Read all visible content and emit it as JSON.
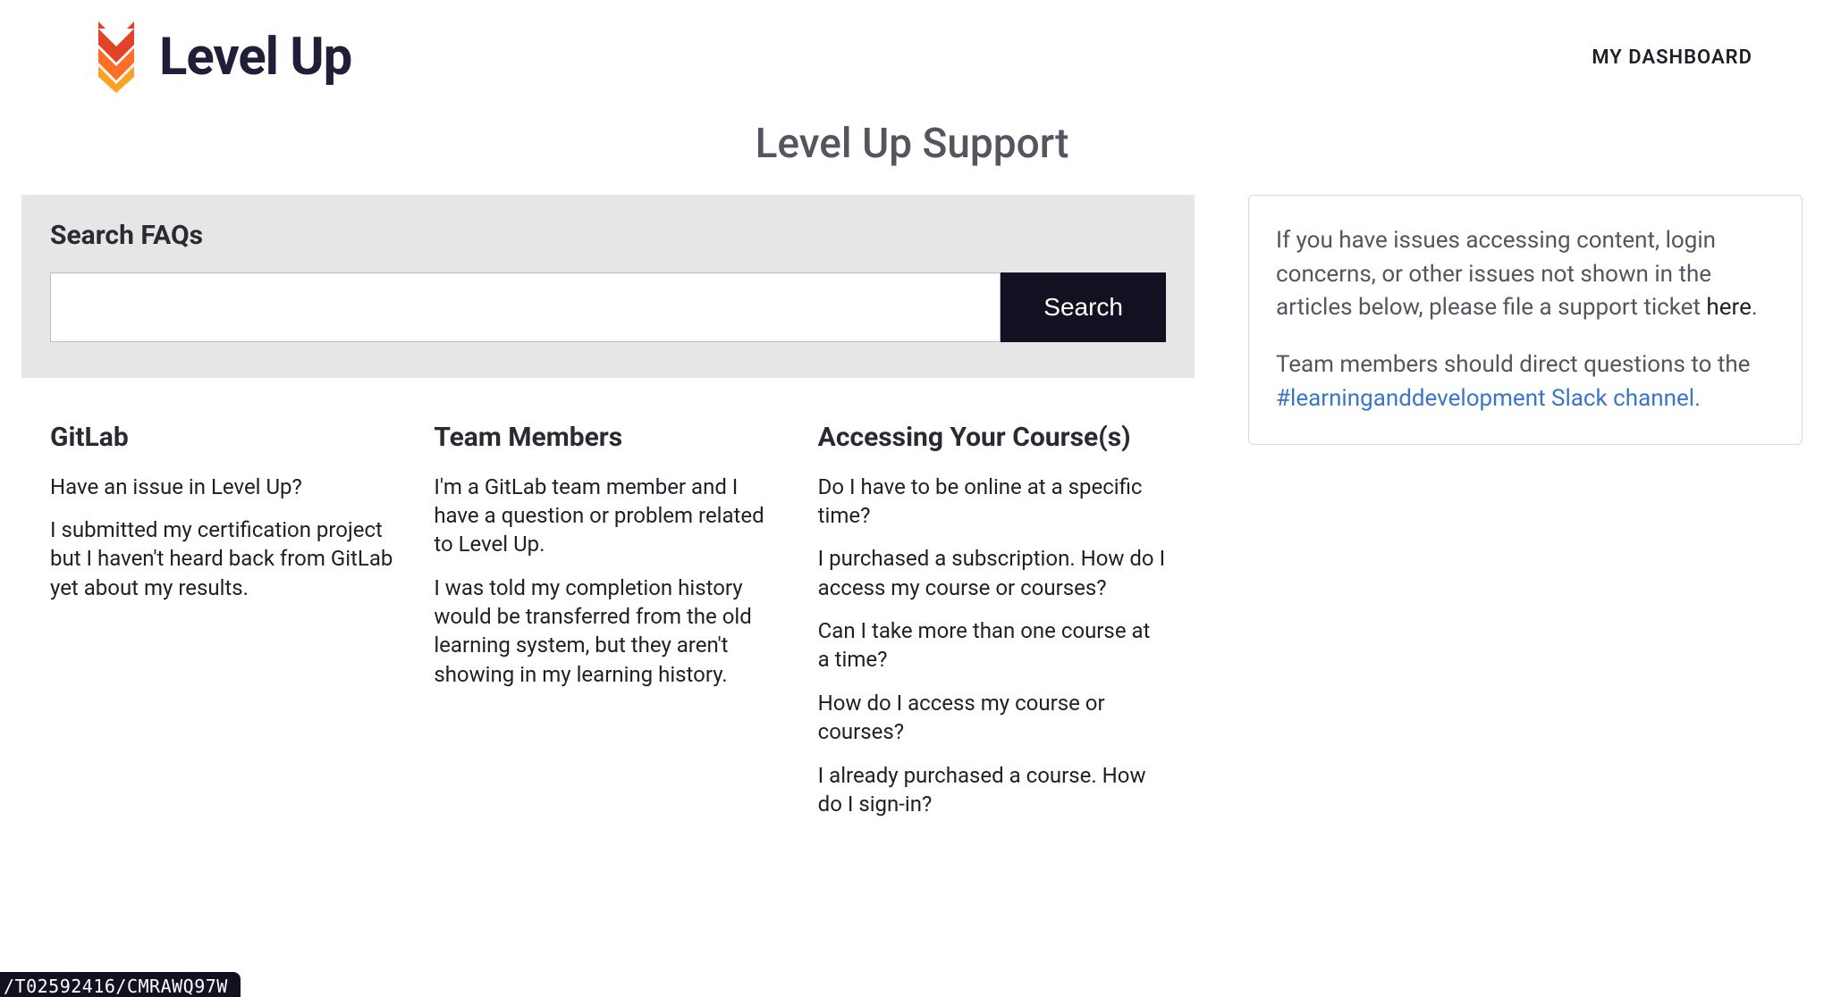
{
  "header": {
    "brand": "Level Up",
    "dashboard_link": "MY DASHBOARD"
  },
  "page_title": "Level Up Support",
  "search": {
    "panel_title": "Search FAQs",
    "button_label": "Search",
    "input_value": ""
  },
  "faq_sections": [
    {
      "heading": "GitLab",
      "items": [
        "Have an issue in Level Up?",
        "I submitted my certification project but I haven't heard back from GitLab yet about my results."
      ]
    },
    {
      "heading": "Team Members",
      "items": [
        "I'm a GitLab team member and I have a question or problem related to Level Up.",
        "I was told my completion history would be transferred from the old learning system, but they aren't showing in my learning history."
      ]
    },
    {
      "heading": "Accessing Your Course(s)",
      "items": [
        "Do I have to be online at a specific time?",
        "I purchased a subscription. How do I access my course or courses?",
        "Can I take more than one course at a time?",
        "How do I access my course or courses?",
        "I already purchased a course. How do I sign-in?"
      ]
    }
  ],
  "notice": {
    "p1_pre": "If you have issues accessing content, login concerns, or other issues not shown in the articles below, please file a support ticket ",
    "p1_link": "here",
    "p1_post": ".",
    "p2_pre": "Team members should direct questions to the ",
    "p2_link": "#learninganddevelopment Slack channel.",
    "p2_post": ""
  },
  "status_fragment": "/T02592416/CMRAWQ97W"
}
